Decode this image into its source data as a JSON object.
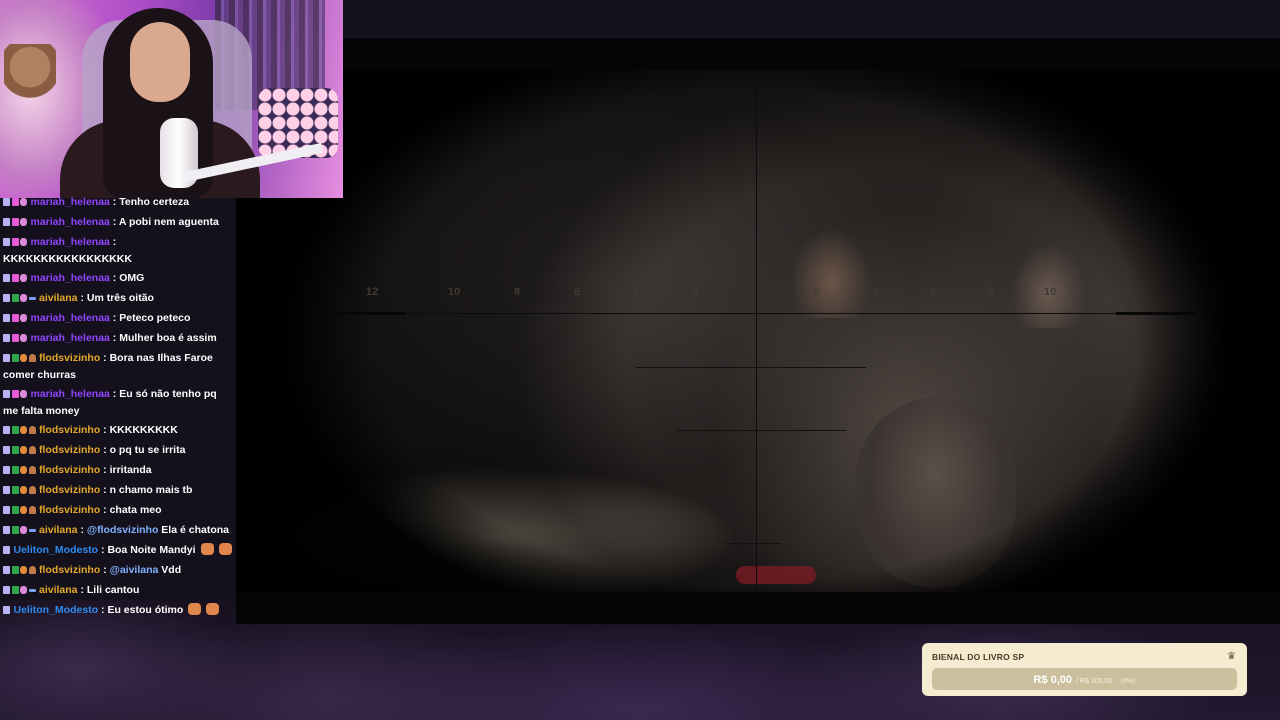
{
  "chat": {
    "messages": [
      {
        "badges": [
          "pen",
          "sub",
          "mod-face"
        ],
        "user": "mariah_helenaa",
        "color": "purple",
        "text": "Tenho certeza"
      },
      {
        "badges": [
          "pen",
          "sub",
          "mod-face"
        ],
        "user": "mariah_helenaa",
        "color": "purple",
        "text": "A pobi nem aguenta"
      },
      {
        "badges": [
          "pen",
          "sub",
          "mod-face"
        ],
        "user": "mariah_helenaa",
        "color": "purple",
        "text": "KKKKKKKKKKKKKKKKK"
      },
      {
        "badges": [
          "pen",
          "sub",
          "mod-face"
        ],
        "user": "mariah_helenaa",
        "color": "purple",
        "text": "OMG"
      },
      {
        "badges": [
          "pen",
          "mod",
          "mod-face",
          "dash"
        ],
        "user": "aivilana",
        "color": "orange",
        "text": "Um três oitão"
      },
      {
        "badges": [
          "pen",
          "sub",
          "mod-face"
        ],
        "user": "mariah_helenaa",
        "color": "purple",
        "text": "Peteco peteco"
      },
      {
        "badges": [
          "pen",
          "sub",
          "mod-face"
        ],
        "user": "mariah_helenaa",
        "color": "purple",
        "text": "Mulher boa é assim"
      },
      {
        "badges": [
          "pen",
          "mod",
          "fox",
          "ear"
        ],
        "user": "flodsvizinho",
        "color": "orange",
        "text": "Bora nas Ilhas Faroe comer churras"
      },
      {
        "badges": [
          "pen",
          "sub",
          "mod-face"
        ],
        "user": "mariah_helenaa",
        "color": "purple",
        "text": "Eu só não tenho pq me falta money"
      },
      {
        "badges": [
          "pen",
          "mod",
          "fox",
          "ear"
        ],
        "user": "flodsvizinho",
        "color": "orange",
        "text": "KKKKKKKKK"
      },
      {
        "badges": [
          "pen",
          "mod",
          "fox",
          "ear"
        ],
        "user": "flodsvizinho",
        "color": "orange",
        "text": "o pq tu se irrita"
      },
      {
        "badges": [
          "pen",
          "mod",
          "fox",
          "ear"
        ],
        "user": "flodsvizinho",
        "color": "orange",
        "text": "irritanda"
      },
      {
        "badges": [
          "pen",
          "mod",
          "fox",
          "ear"
        ],
        "user": "flodsvizinho",
        "color": "orange",
        "text": "n chamo mais tb"
      },
      {
        "badges": [
          "pen",
          "mod",
          "fox",
          "ear"
        ],
        "user": "flodsvizinho",
        "color": "orange",
        "text": "chata meo"
      },
      {
        "badges": [
          "pen",
          "mod",
          "mod-face",
          "dash"
        ],
        "user": "aivilana",
        "color": "orange",
        "mention": "@flodsvizinho",
        "text": "Ela é chatona"
      },
      {
        "badges": [
          "pen"
        ],
        "user": "Ueliton_Modesto",
        "color": "blue",
        "text": "Boa Noite Mandyi",
        "emotes": 2
      },
      {
        "badges": [
          "pen",
          "mod",
          "fox",
          "ear"
        ],
        "user": "flodsvizinho",
        "color": "orange",
        "mention": "@aivilana",
        "text": "Vdd"
      },
      {
        "badges": [
          "pen",
          "mod",
          "mod-face",
          "dash"
        ],
        "user": "aivilana",
        "color": "orange",
        "text": "Lili cantou"
      },
      {
        "badges": [
          "pen"
        ],
        "user": "Ueliton_Modesto",
        "color": "blue",
        "text": "Eu estou ótimo",
        "emotes": 2
      }
    ]
  },
  "scope": {
    "marks": [
      "12",
      "10",
      "8",
      "6",
      "4",
      "2",
      "2",
      "4",
      "6",
      "8",
      "10"
    ]
  },
  "goal": {
    "title": "BIENAL DO LIVRO SP",
    "icon": "crown-icon",
    "current": "R$ 0,00",
    "target": "/ R$ 300,00",
    "percent": "(0%)",
    "progress": 0
  },
  "colors": {
    "purple": "#9146ff",
    "orange": "#e5a92c",
    "blue": "#2e8bf0",
    "goal_bg": "#f5ebd0"
  }
}
